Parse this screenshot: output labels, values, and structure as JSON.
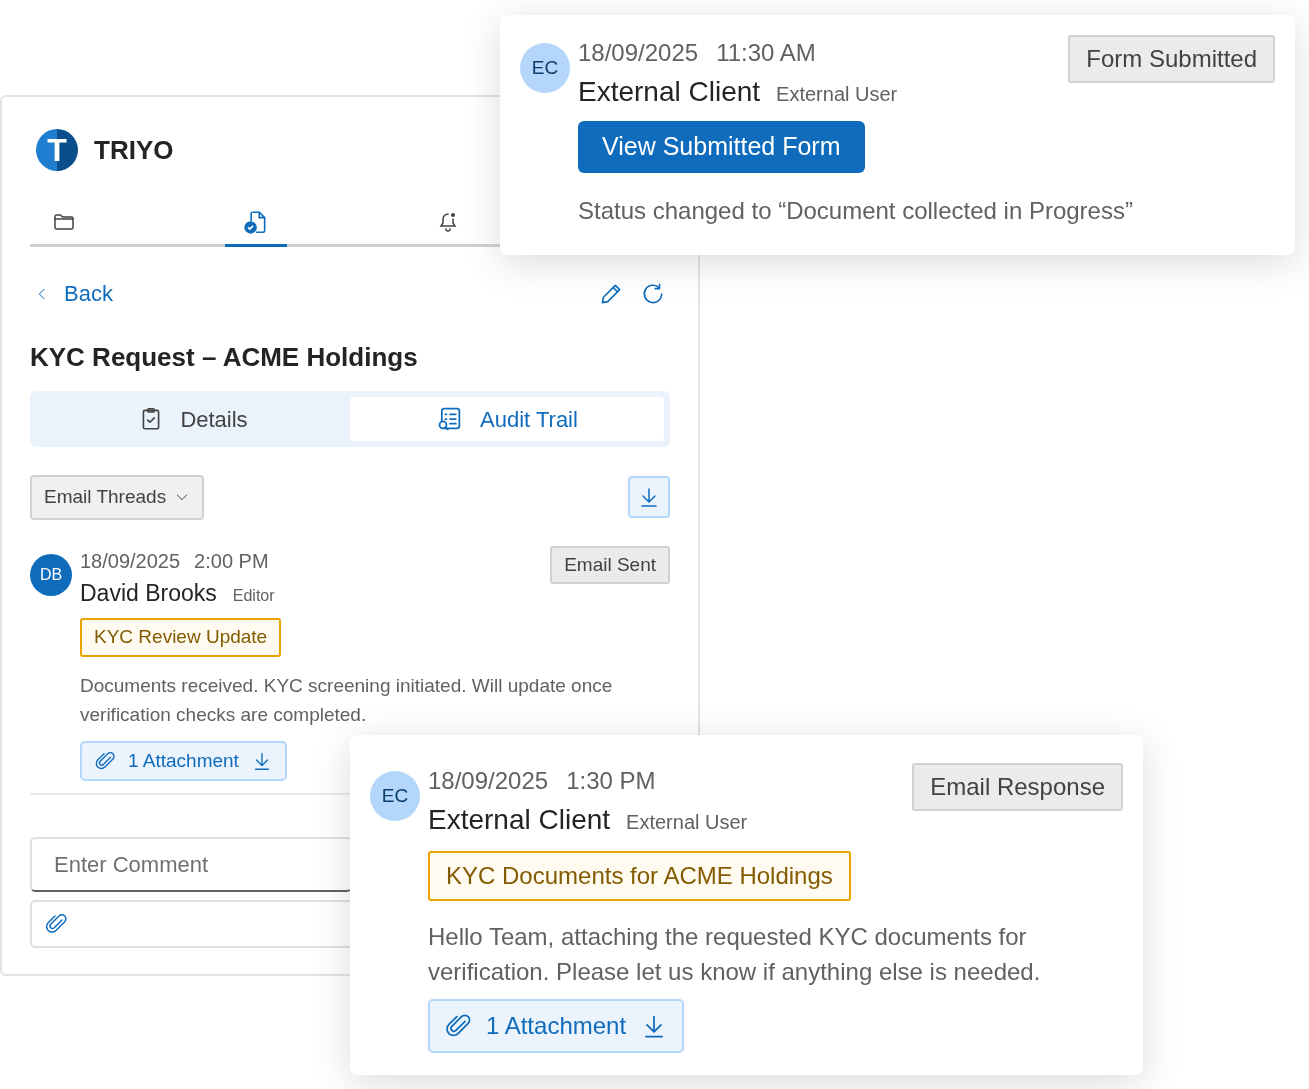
{
  "app": {
    "logo_letter": "T",
    "name": "TRIYO"
  },
  "nav_tabs": [
    {
      "selected": false
    },
    {
      "selected": true
    },
    {
      "selected": false
    }
  ],
  "back": "Back",
  "title": "KYC Request – ACME Holdings",
  "view_tabs": [
    {
      "label": "Details",
      "selected": false
    },
    {
      "label": "Audit Trail",
      "selected": true
    }
  ],
  "filter": "Email Threads",
  "thread_entries": [
    {
      "avatar": {
        "initials": "DB",
        "color": "#0f6cbd"
      },
      "date": "18/09/2025",
      "time": "2:00 PM",
      "name": "David Brooks",
      "role": "Editor",
      "event": "Email Sent",
      "subject": "KYC Review Update",
      "message": "Documents received. KYC screening initiated. Will update once verification checks are completed.",
      "attachment": "1 Attachment"
    }
  ],
  "comment": {
    "placeholder": "Enter Comment"
  },
  "floating_cards": [
    {
      "avatar": {
        "initials": "EC",
        "color": "#b4d6fa"
      },
      "date": "18/09/2025",
      "time": "11:30 AM",
      "name": "External Client",
      "role": "External User",
      "event": "Form Submitted",
      "action": "View Submitted Form",
      "status": "Status changed to “Document collected in Progress”"
    },
    {
      "avatar": {
        "initials": "EC",
        "color": "#b4d6fa"
      },
      "date": "18/09/2025",
      "time": "1:30 PM",
      "name": "External Client",
      "role": "External User",
      "event": "Email Response",
      "subject": "KYC Documents for ACME Holdings",
      "message": "Hello Team, attaching the requested KYC documents for verification. Please let us know if anything else is needed.",
      "attachment": "1 Attachment"
    }
  ]
}
